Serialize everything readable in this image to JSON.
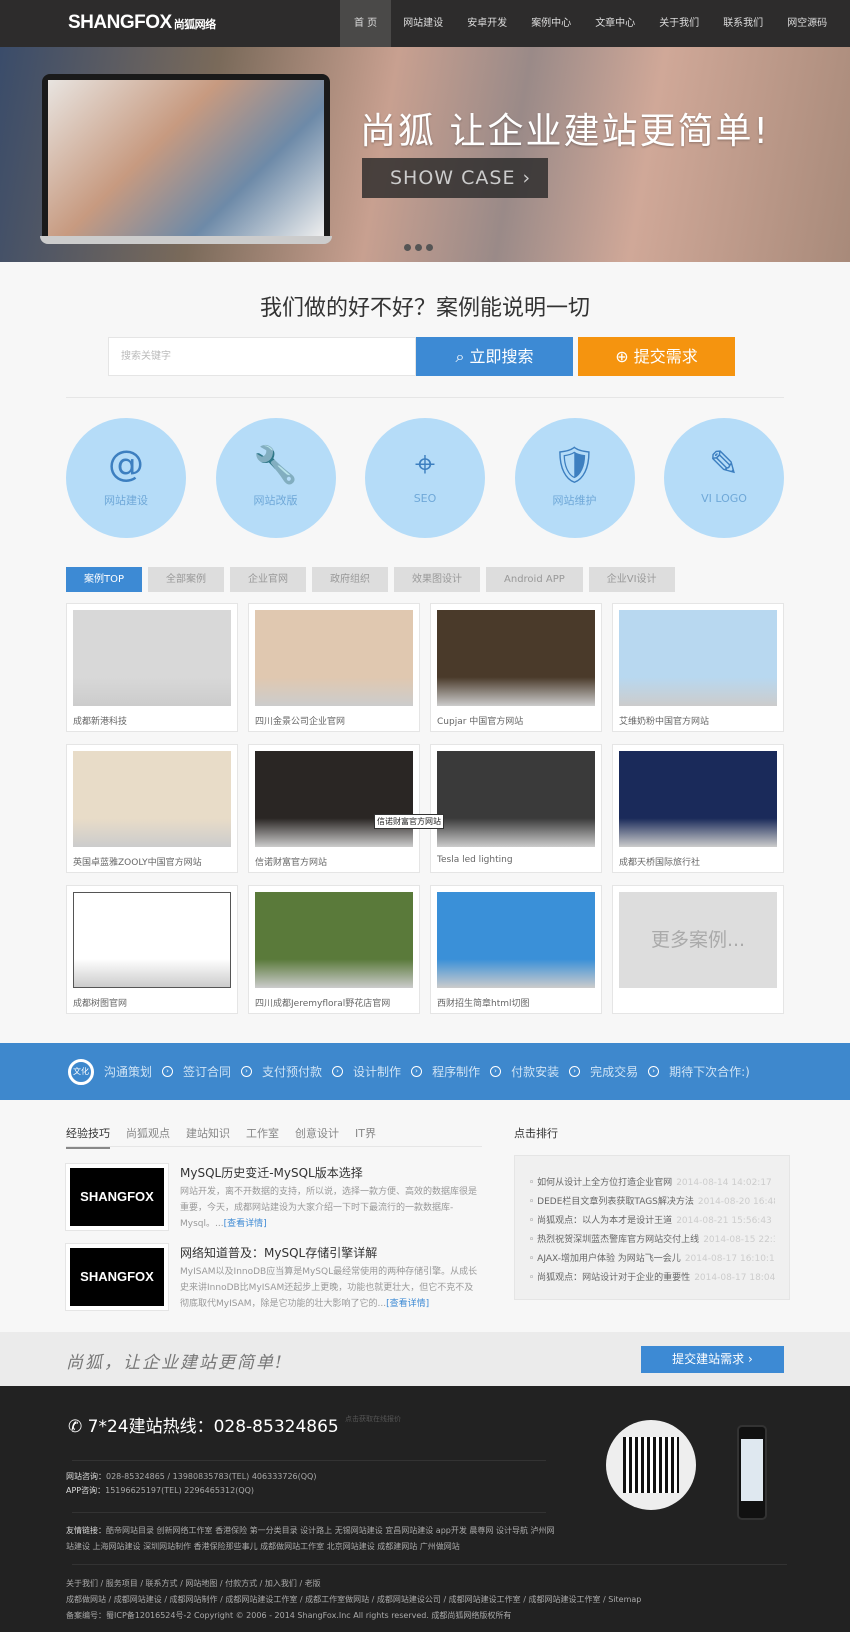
{
  "header": {
    "logo": "SHANGFOX",
    "logo_cn": "尚狐网络",
    "nav": [
      "首 页",
      "网站建设",
      "安卓开发",
      "案例中心",
      "文章中心",
      "关于我们",
      "联系我们",
      "网空源码"
    ]
  },
  "banner": {
    "title": "尚狐  让企业建站更简单!",
    "button": "SHOW CASE"
  },
  "search": {
    "heading": "我们做的好不好？案例能说明一切",
    "placeholder": "搜索关键字",
    "search_btn": "立即搜索",
    "submit_btn": "提交需求"
  },
  "services": [
    {
      "icon": "@",
      "label": "网站建设"
    },
    {
      "icon": "🔧",
      "label": "网站改版"
    },
    {
      "icon": "⌖",
      "label": "SEO"
    },
    {
      "icon": "🛡",
      "label": "网站维护"
    },
    {
      "icon": "✎",
      "label": "VI LOGO"
    }
  ],
  "case_tabs": [
    "案例TOP",
    "全部案例",
    "企业官网",
    "政府组织",
    "效果图设计",
    "Android APP",
    "企业VI设计"
  ],
  "cases": [
    {
      "caption": "成都新港科技",
      "color": "#d8d8d8"
    },
    {
      "caption": "四川金景公司企业官网",
      "color": "#e0c8b0"
    },
    {
      "caption": "Cupjar 中国官方网站",
      "color": "#4a3a2a"
    },
    {
      "caption": "艾维奶粉中国官方网站",
      "color": "#b8d8f0"
    },
    {
      "caption": "英国卓蓝雅ZOOLY中国官方网站",
      "color": "#e8dcc8"
    },
    {
      "caption": "信诺财富官方网站",
      "color": "#2a2624"
    },
    {
      "caption": "Tesla led lighting",
      "color": "#3a3a3a"
    },
    {
      "caption": "成都天桥国际旅行社",
      "color": "#1a2a5a"
    },
    {
      "caption": "成都树图官网",
      "color": "#ffffff"
    },
    {
      "caption": "四川成都Jeremyfloral野花店官网",
      "color": "#5a7a3a"
    },
    {
      "caption": "西财招生简章html切图",
      "color": "#3a90d8"
    }
  ],
  "more_cases": "更多案例...",
  "tooltip": "信诺财富官方网站",
  "flow": {
    "badge": "文化",
    "steps": [
      "沟通策划",
      "签订合同",
      "支付预付款",
      "设计制作",
      "程序制作",
      "付款安装",
      "完成交易",
      "期待下次合作:)"
    ]
  },
  "articles": {
    "tabs": [
      "经验技巧",
      "尚狐观点",
      "建站知识",
      "工作室",
      "创意设计",
      "IT界"
    ],
    "items": [
      {
        "thumb": "SHANGFOX",
        "title": "MySQL历史变迁-MySQL版本选择",
        "desc": "网站开发，离不开数据的支持，所以说，选择一款方便、高效的数据库很是重要，今天，成都网站建设为大家介绍一下时下最流行的一款数据库-Mysql。...",
        "more": "[查看详情]"
      },
      {
        "thumb": "SHANGFOX",
        "title": "网络知道普及：MySQL存储引擎详解",
        "desc": "MyISAM以及InnoDB应当算是MySQL最经常使用的两种存储引擎。从成长史来讲InnoDB比MyISAM还起步上更晚，功能也就更壮大，但它不克不及彻底取代MyISAM，除是它功能的壮大影响了它的...",
        "more": "[查看详情]"
      }
    ]
  },
  "ranking": {
    "title": "点击排行",
    "items": [
      {
        "t": "如何从设计上全方位打造企业官网",
        "d": "2014-08-14 14:02:17"
      },
      {
        "t": "DEDE栏目文章列表获取TAGS解决方法",
        "d": "2014-08-20 16:48:51"
      },
      {
        "t": "尚狐观点：以人为本才是设计王道",
        "d": "2014-08-21 15:56:43"
      },
      {
        "t": "热烈祝贺深圳蓝杰警库官方网站交付上线",
        "d": "2014-08-15 22:38:04"
      },
      {
        "t": "AJAX-增加用户体验 为网站飞一会儿",
        "d": "2014-08-17 16:10:17"
      },
      {
        "t": "尚狐观点：网站设计对于企业的重要性",
        "d": "2014-08-17 18:04:13"
      }
    ]
  },
  "slogan": {
    "text": "尚狐，让企业建站更简单!",
    "button": "提交建站需求"
  },
  "footer": {
    "hotline": "7*24建站热线：028-85324865",
    "hotline_note": "点击获取在线报价",
    "consult_label": "网站咨询：",
    "consult": "028-85324865 / 13980835783(TEL) 406333726(QQ)",
    "app_label": "APP咨询：",
    "app": "15196625197(TEL) 2296465312(QQ)",
    "links_label": "友情链接：",
    "links": "酷帝网站目录  创新网络工作室  香港保险  第一分类目录  设计路上  无锡网站建设  宜昌网站建设  app开发  晨尊网  设计导航  泸州网站建设  上海网站建设  深圳网站制作  香港保险那些事儿  成都做网站工作室  北京网站建设  成都建网站  广州做网站",
    "nav1": "关于我们 / 服务项目 / 联系方式 / 网站地图 / 付款方式 / 加入我们 / 老版",
    "nav2": "成都做网站 / 成都网站建设 / 成都网站制作 / 成都网站建设工作室 / 成都工作室做网站 / 成都网站建设公司 / 成都网站建设工作室 / 成都网站建设工作室 / Sitemap",
    "copyright": "备案编号：蜀ICP备12016524号-2 Copyright © 2006 - 2014 ShangFox.Inc All rights reserved. 成都尚狐网络版权所有"
  }
}
